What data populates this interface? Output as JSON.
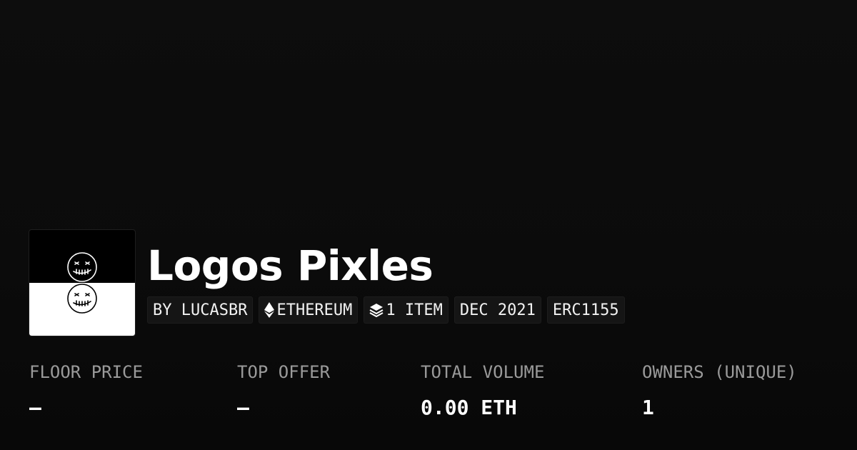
{
  "collection": {
    "title": "Logos Pixles",
    "logo_icon": "smiley-face-icon"
  },
  "tags": [
    {
      "label": "BY LUCASBR",
      "icon": null
    },
    {
      "label": "ETHEREUM",
      "icon": "ethereum-icon"
    },
    {
      "label": "1 ITEM",
      "icon": "layers-icon"
    },
    {
      "label": "DEC 2021",
      "icon": null
    },
    {
      "label": "ERC1155",
      "icon": null
    }
  ],
  "stats": [
    {
      "label": "FLOOR PRICE",
      "value": "—"
    },
    {
      "label": "TOP OFFER",
      "value": "—"
    },
    {
      "label": "TOTAL VOLUME",
      "value": "0.00 ETH"
    },
    {
      "label": "OWNERS (UNIQUE)",
      "value": "1"
    }
  ]
}
